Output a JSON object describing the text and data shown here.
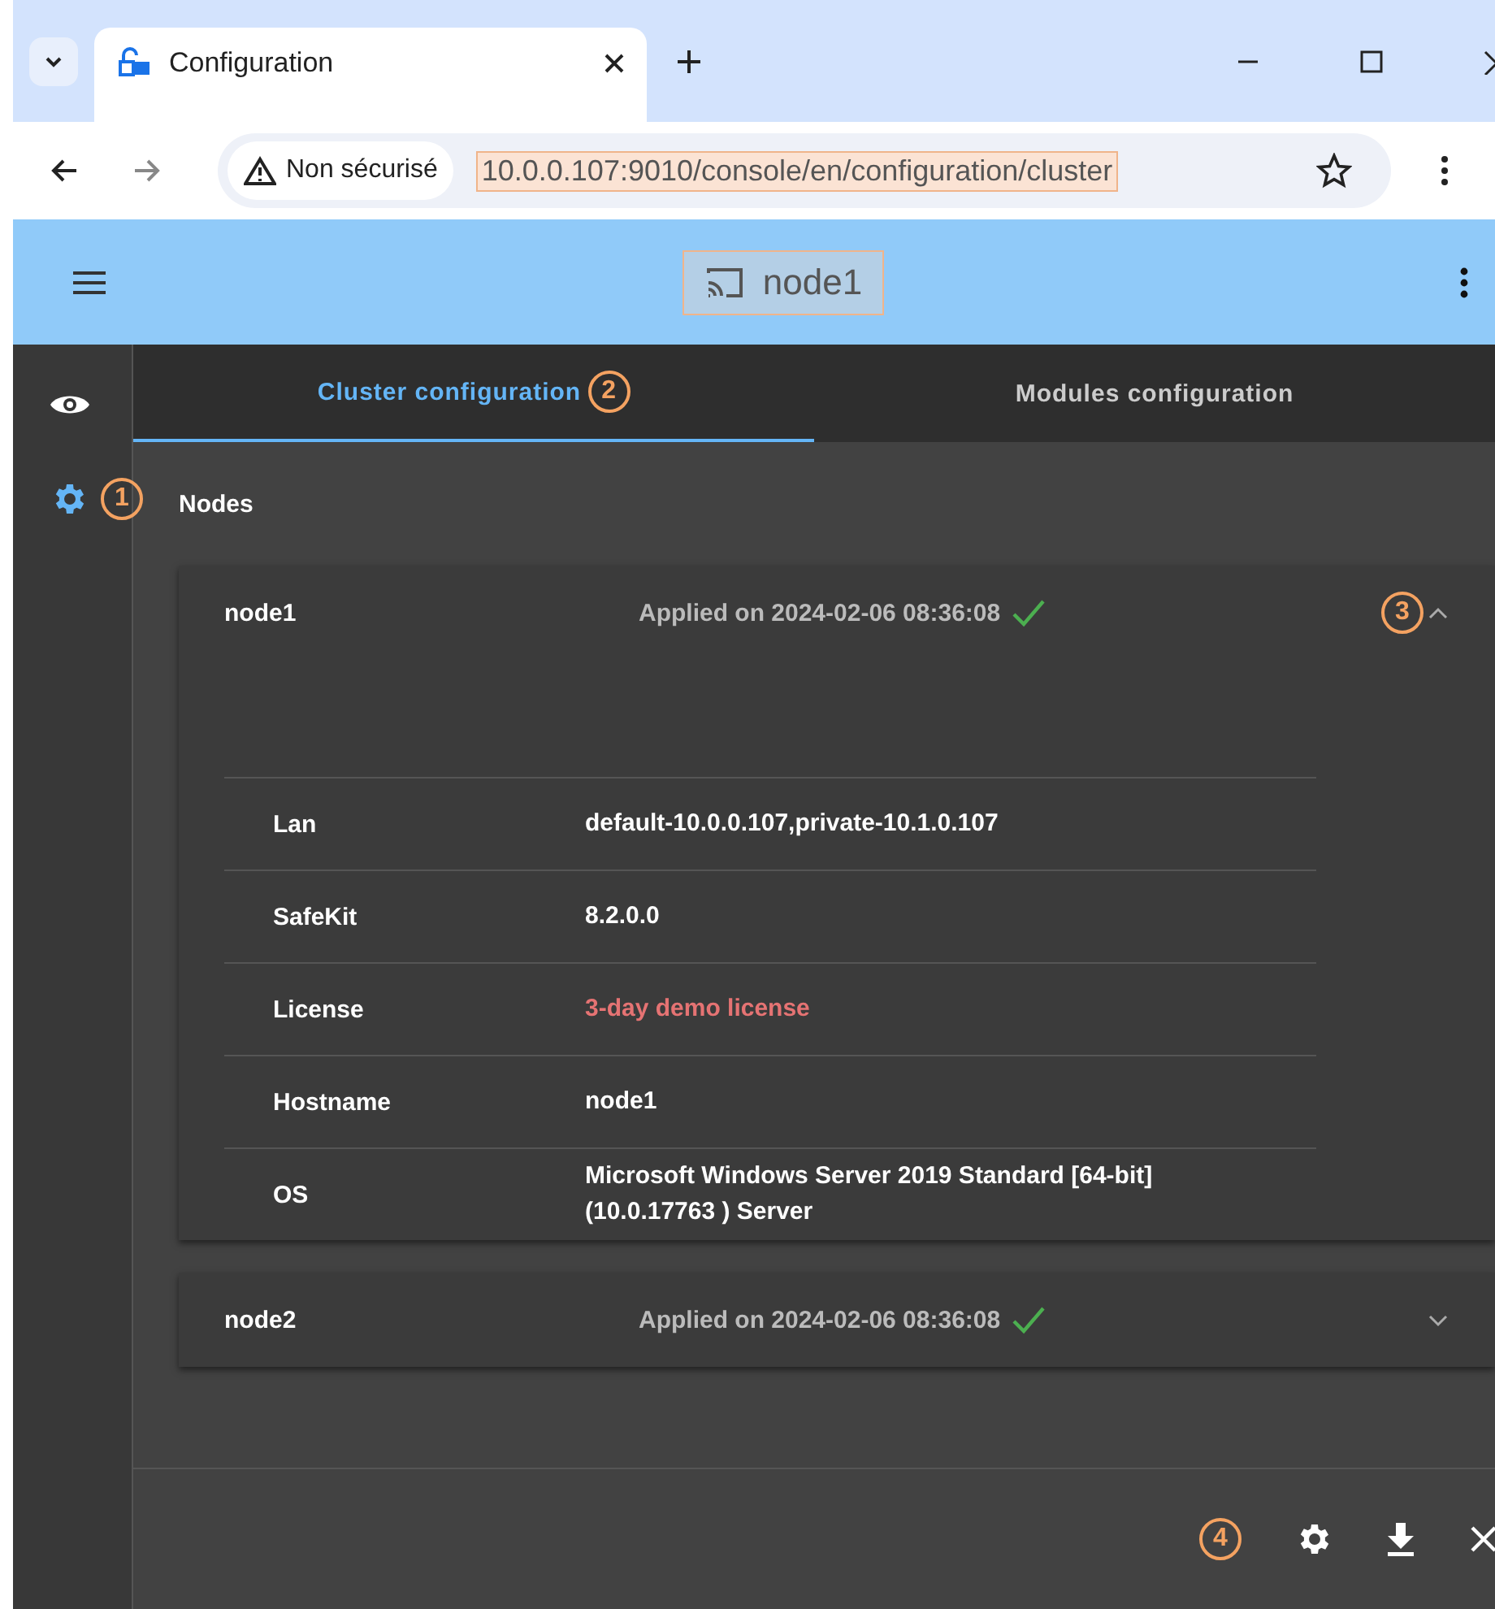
{
  "browser": {
    "tab_title": "Configuration",
    "security_label": "Non sécurisé",
    "url": "10.0.0.107:9010/console/en/configuration/cluster"
  },
  "header": {
    "title": "node1"
  },
  "sidebar": {
    "items": [
      {
        "kind": "view",
        "selected": false
      },
      {
        "kind": "settings",
        "selected": true,
        "callout": "1"
      }
    ]
  },
  "tabs": [
    {
      "label": "Cluster configuration",
      "selected": true,
      "callout": "2"
    },
    {
      "label": "Modules configuration",
      "selected": false
    }
  ],
  "section_title": "Nodes",
  "nodes": [
    {
      "name": "node1",
      "status": "Applied on 2024-02-06 08:36:08",
      "expanded": true,
      "callout": "3",
      "details": [
        {
          "label": "Lan",
          "value": "default-10.0.0.107,private-10.1.0.107",
          "kind": "normal"
        },
        {
          "label": "SafeKit",
          "value": "8.2.0.0",
          "kind": "normal"
        },
        {
          "label": "License",
          "value": "3-day demo license",
          "kind": "warning"
        },
        {
          "label": "Hostname",
          "value": "node1",
          "kind": "normal"
        },
        {
          "label": "OS",
          "value": "Microsoft Windows Server 2019 Standard [64-bit] (10.0.17763 ) Server",
          "kind": "normal"
        }
      ]
    },
    {
      "name": "node2",
      "status": "Applied on 2024-02-06 08:36:08",
      "expanded": false
    }
  ],
  "footer": {
    "callout": "4"
  }
}
